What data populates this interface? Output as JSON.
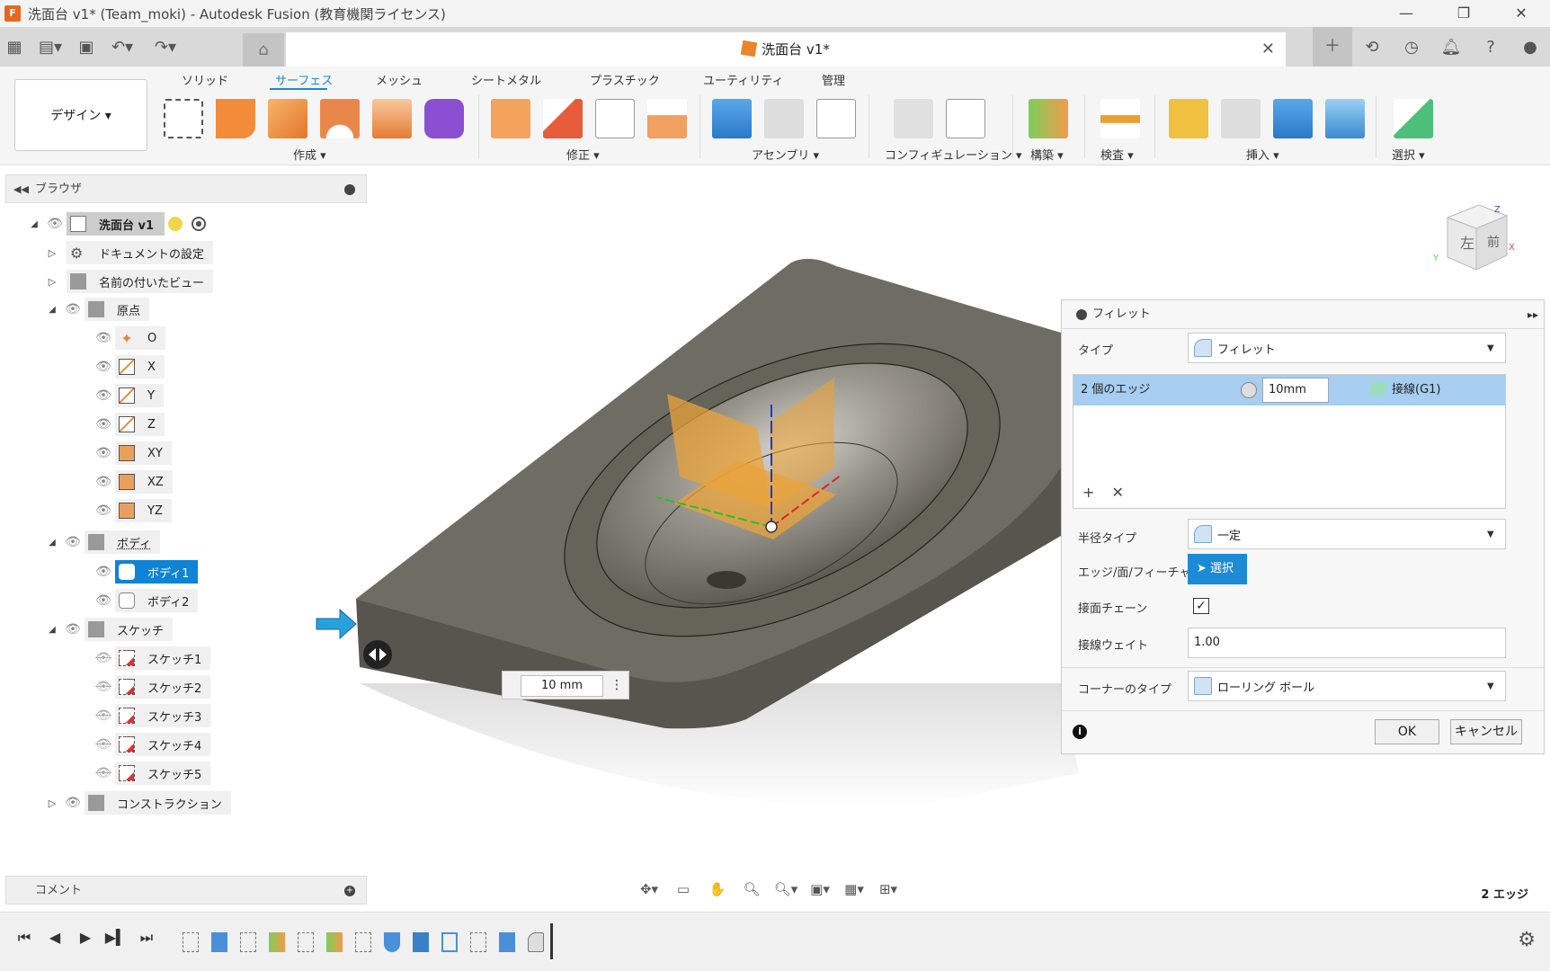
{
  "window": {
    "title": "洗面台 v1* (Team_moki) - Autodesk Fusion (教育機関ライセンス)",
    "app_icon_label": "F",
    "controls": [
      "—",
      "❐",
      "✕"
    ]
  },
  "document_tab": {
    "title": "洗面台 v1*",
    "close": "✕"
  },
  "quick_access": {
    "icons": [
      "grid-icon",
      "file-icon",
      "save-icon",
      "undo-icon",
      "redo-icon"
    ],
    "home_icon": "home-icon",
    "right_icons": [
      "plus-icon",
      "extensions-icon",
      "clock-icon",
      "bell-icon",
      "help-icon",
      "avatar-icon"
    ]
  },
  "ribbon": {
    "workspace_button": "デザイン ▾",
    "tabs": [
      "ソリッド",
      "サーフェス",
      "メッシュ",
      "シートメタル",
      "プラスチック",
      "ユーティリティ",
      "管理"
    ],
    "active_tab": "サーフェス",
    "groups": [
      "作成 ▾",
      "修正 ▾",
      "アセンブリ ▾",
      "コンフィギュレーション ▾",
      "構築 ▾",
      "検査 ▾",
      "挿入 ▾",
      "選択 ▾"
    ]
  },
  "browser": {
    "title": "ブラウザ",
    "root": "洗面台 v1",
    "items": [
      {
        "label": "ドキュメントの設定"
      },
      {
        "label": "名前の付いたビュー"
      },
      {
        "label": "原点"
      },
      {
        "label": "O"
      },
      {
        "label": "X"
      },
      {
        "label": "Y"
      },
      {
        "label": "Z"
      },
      {
        "label": "XY"
      },
      {
        "label": "XZ"
      },
      {
        "label": "YZ"
      },
      {
        "label": "ボディ"
      },
      {
        "label": "ボディ1"
      },
      {
        "label": "ボディ2"
      },
      {
        "label": "スケッチ"
      },
      {
        "label": "スケッチ1"
      },
      {
        "label": "スケッチ2"
      },
      {
        "label": "スケッチ3"
      },
      {
        "label": "スケッチ4"
      },
      {
        "label": "スケッチ5"
      },
      {
        "label": "コンストラクション"
      }
    ]
  },
  "comments": {
    "title": "コメント"
  },
  "viewcube": {
    "face_left": "左",
    "face_front": "前",
    "axis_z": "Z",
    "axis_x": "X",
    "axis_y": "Y"
  },
  "viewport": {
    "dimension_value": "10 mm",
    "dimension_menu": "⋮"
  },
  "fillet_dialog": {
    "title": "フィレット",
    "expand": "▸▸",
    "type_label": "タイプ",
    "type_value": "フィレット",
    "edge_count": "2 個のエッジ",
    "radius_value": "10mm",
    "continuity": "接線(G1)",
    "add": "+",
    "remove": "✕",
    "radius_type_label": "半径タイプ",
    "radius_type_value": "一定",
    "entity_label": "エッジ/面/フィーチャ",
    "select_button": "選択",
    "tangent_chain_label": "接面チェーン",
    "tangent_chain_checked": "✓",
    "tangent_weight_label": "接線ウェイト",
    "tangent_weight_value": "1.00",
    "corner_type_label": "コーナーのタイプ",
    "corner_type_value": "ローリング ボール",
    "info": "i",
    "ok": "OK",
    "cancel": "キャンセル"
  },
  "status": {
    "selection": "2 エッジ"
  },
  "colors": {
    "accent": "#1a8ad4",
    "selected_row": "#a7cdf0",
    "model_top": "#6e6b61",
    "model_side": "#55534b",
    "plane_orange": "#e9a33a"
  }
}
